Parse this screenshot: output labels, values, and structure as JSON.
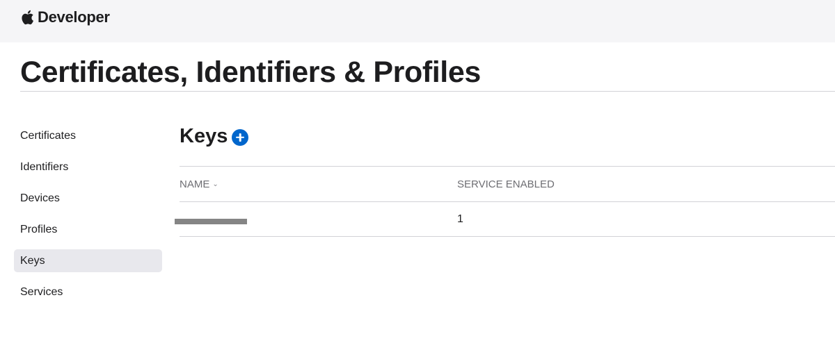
{
  "header": {
    "brand_text": "Developer",
    "brand_icon": "apple-logo"
  },
  "page": {
    "title": "Certificates, Identifiers & Profiles"
  },
  "sidebar": {
    "items": [
      {
        "label": "Certificates",
        "active": false
      },
      {
        "label": "Identifiers",
        "active": false
      },
      {
        "label": "Devices",
        "active": false
      },
      {
        "label": "Profiles",
        "active": false
      },
      {
        "label": "Keys",
        "active": true
      },
      {
        "label": "Services",
        "active": false
      }
    ]
  },
  "section": {
    "title": "Keys",
    "add_icon": "plus-circle-icon"
  },
  "table": {
    "columns": [
      "NAME",
      "SERVICE ENABLED"
    ],
    "sort_icon": "chevron-down-icon",
    "rows": [
      {
        "name": "[redacted]",
        "service_enabled": "1"
      }
    ]
  },
  "colors": {
    "accent": "#0066cc",
    "header_bg": "#f5f5f7",
    "active_bg": "#e8e8ed",
    "redaction": "#858585"
  }
}
